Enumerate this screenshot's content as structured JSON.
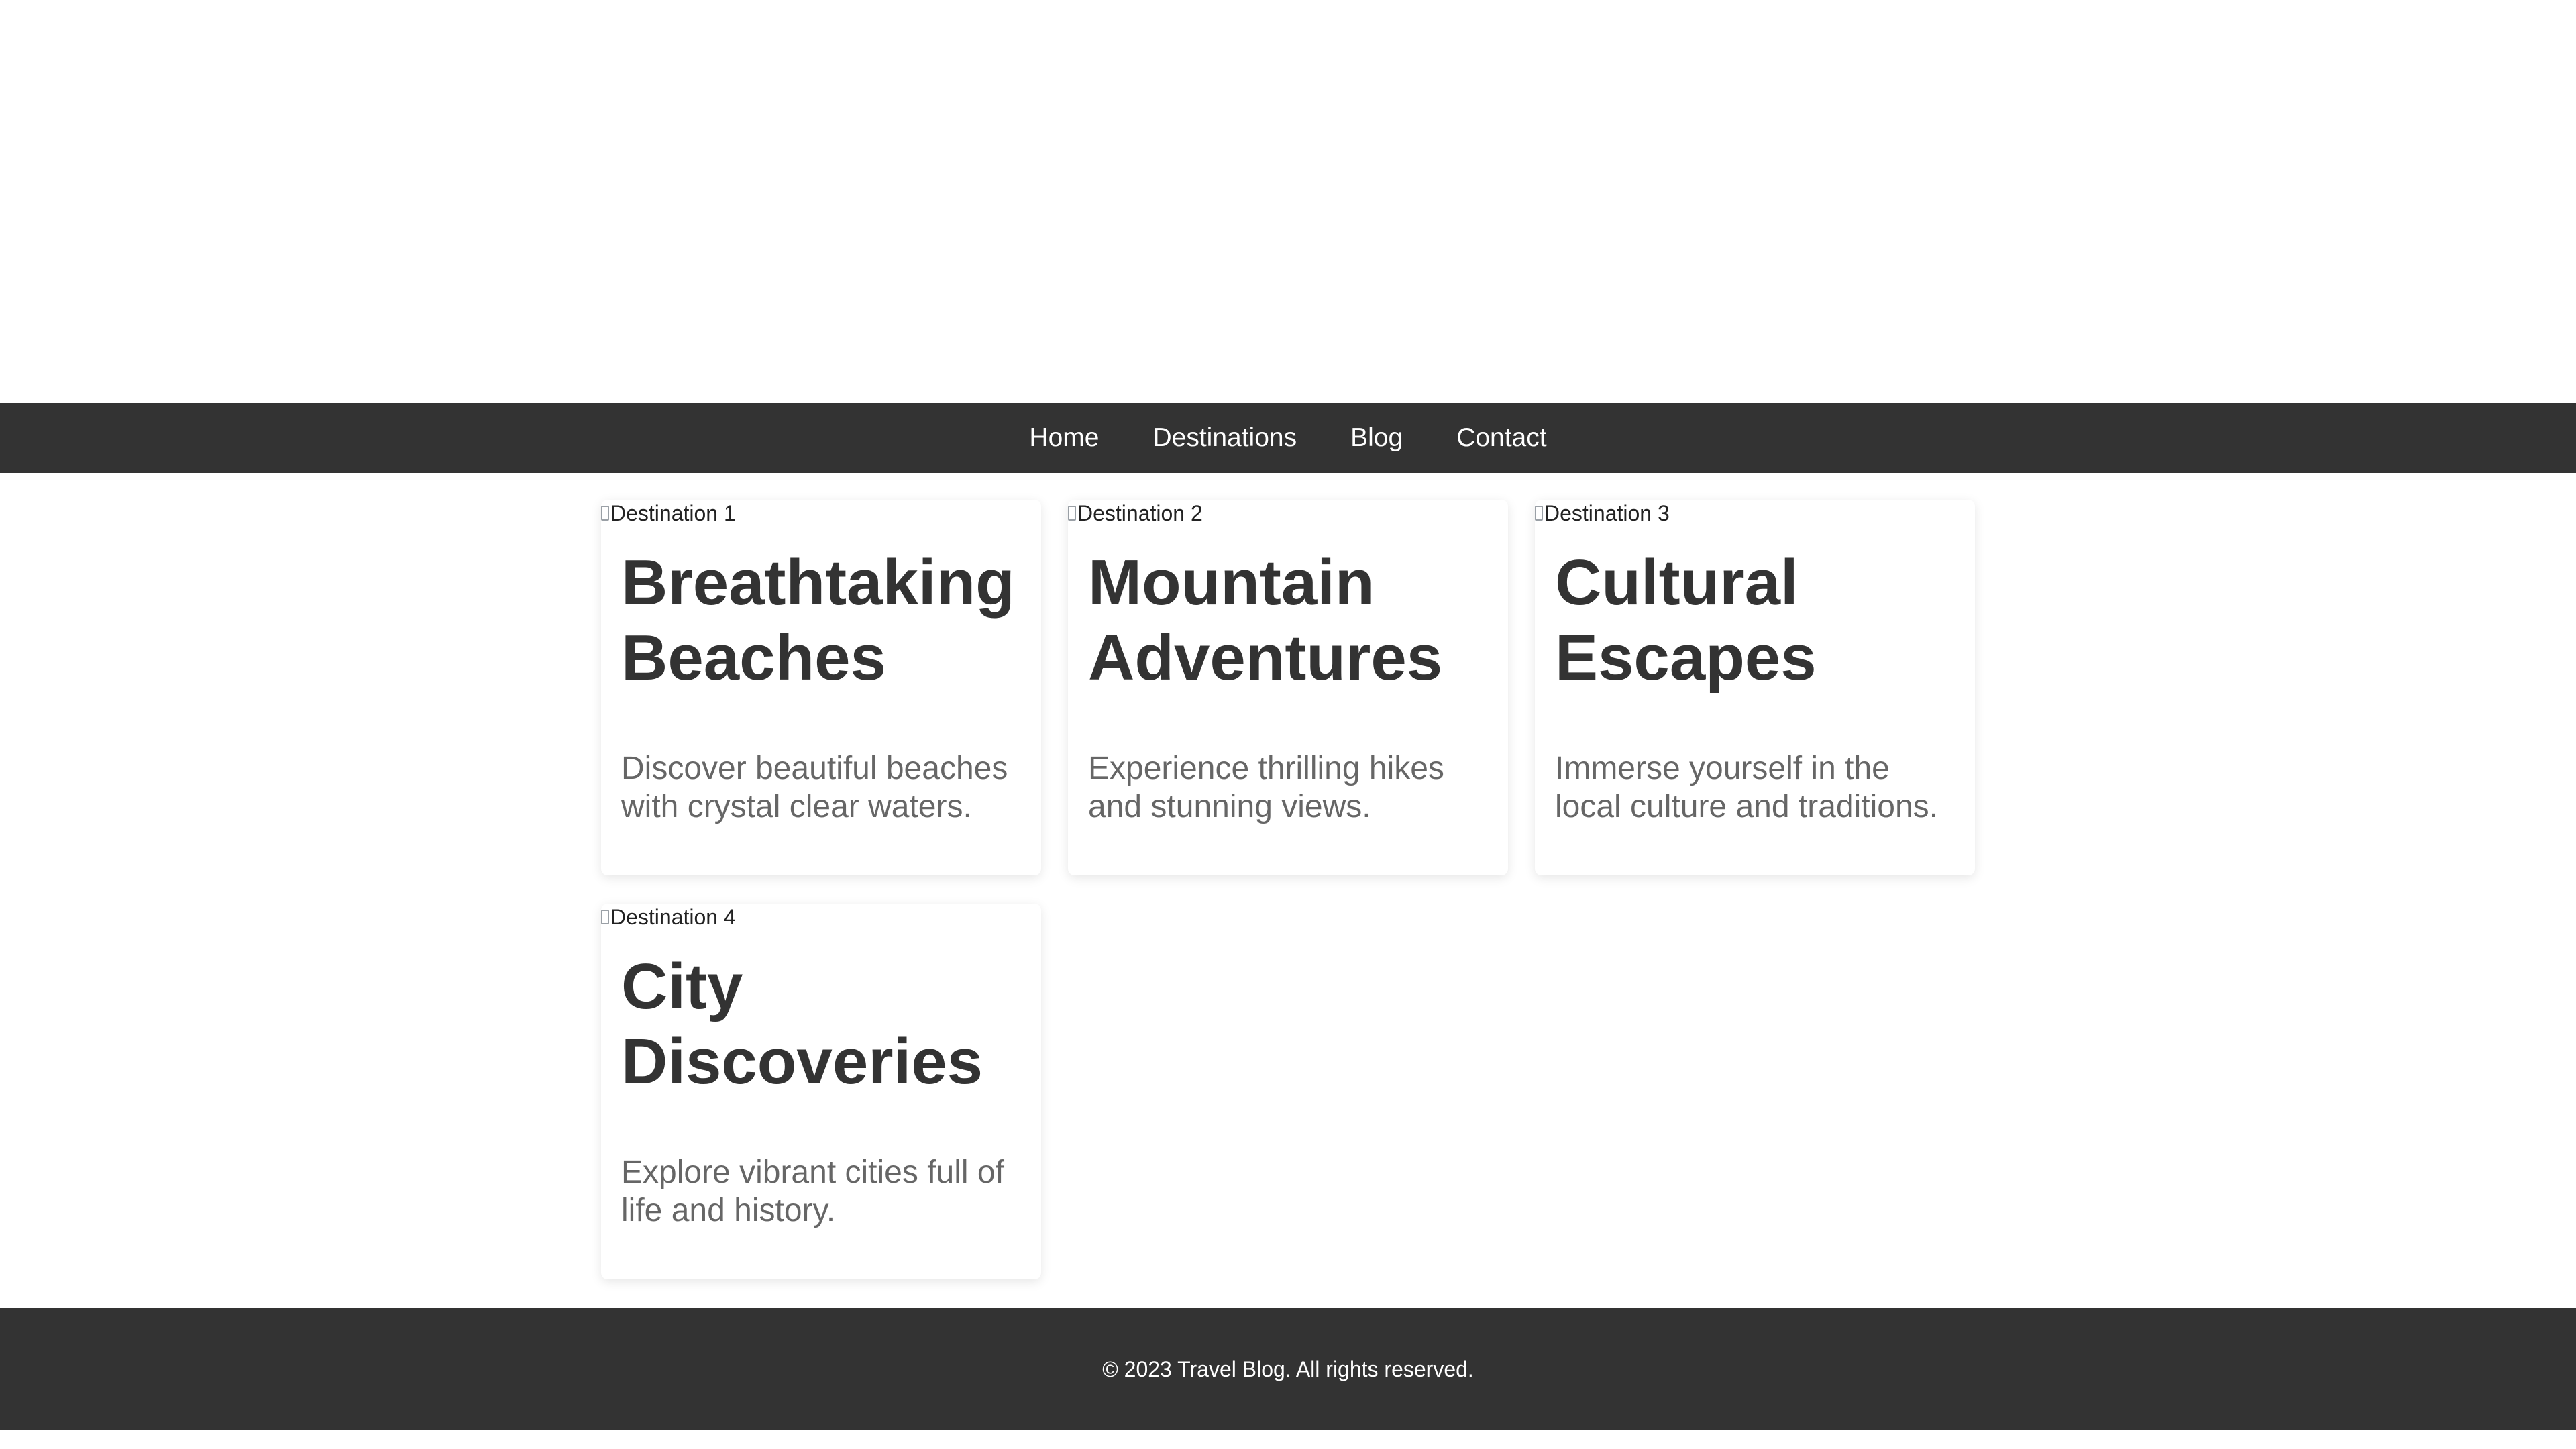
{
  "nav": {
    "items": [
      {
        "label": "Home"
      },
      {
        "label": "Destinations"
      },
      {
        "label": "Blog"
      },
      {
        "label": "Contact"
      }
    ]
  },
  "cards": [
    {
      "image_alt": "Destination 1",
      "title": "Breathtaking Beaches",
      "description": "Discover beautiful beaches with crystal clear waters."
    },
    {
      "image_alt": "Destination 2",
      "title": "Mountain Adventures",
      "description": "Experience thrilling hikes and stunning views."
    },
    {
      "image_alt": "Destination 3",
      "title": "Cultural Escapes",
      "description": "Immerse yourself in the local culture and traditions."
    },
    {
      "image_alt": "Destination 4",
      "title": "City Discoveries",
      "description": "Explore vibrant cities full of life and history."
    }
  ],
  "footer": {
    "copyright": "© 2023 Travel Blog. All rights reserved."
  },
  "colors": {
    "nav_background": "#333333",
    "footer_background": "#333333",
    "title_text": "#333333",
    "description_text": "#666666"
  }
}
